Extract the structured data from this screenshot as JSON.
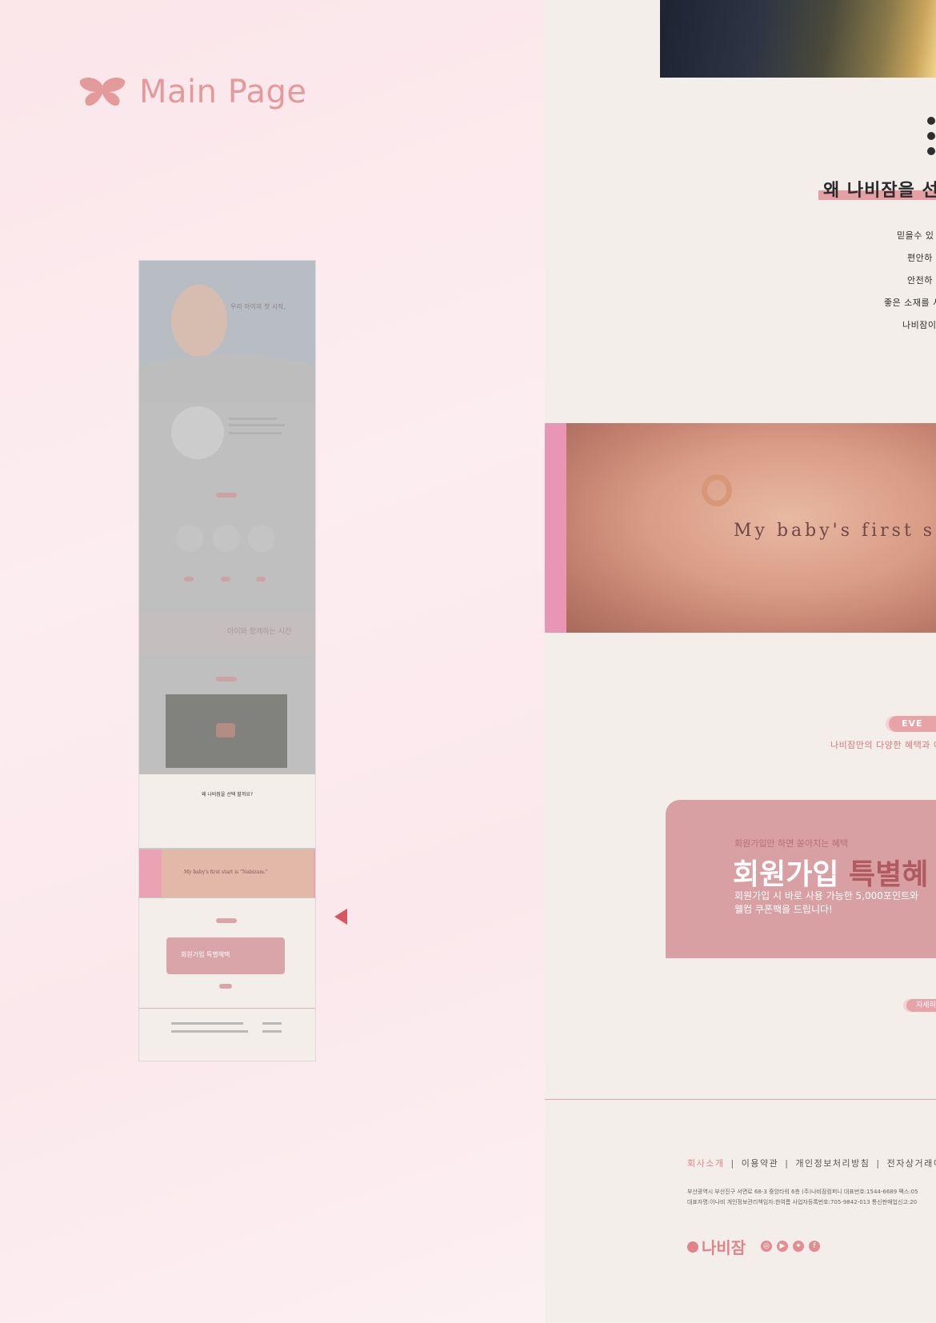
{
  "left": {
    "title": "Main Page",
    "thumbnail": {
      "hero_text": "우리 아이의 첫 시작,",
      "band_text": "아이와 함께하는 시간",
      "cream_title": "왜 나비잠을 선택 할까요?",
      "hand_text": "My baby's first start is \"Nabizam.\"",
      "card_text": "회원가입 특별혜택"
    }
  },
  "right": {
    "why_title": "왜 나비잠을 선",
    "reasons": [
      "믿을수 있",
      "편안하",
      "안전하",
      "좋은 소재를 사",
      "나비잠이"
    ],
    "hero_text": "My baby's first s",
    "event": {
      "pill": "EVE",
      "subtitle": "나비잠만의 다양한 혜택과 이"
    },
    "member": {
      "small": "회원가입만 하면 쏟아지는 혜택",
      "title_main": "회원가입 ",
      "title_accent": "특별혜",
      "desc_line1": "회원가입 시 바로 사용 가능한 5,000포인트와",
      "desc_line2": "웰컴 쿠폰팩을 드립니다!"
    },
    "detail_button": "자세히",
    "footer": {
      "links": [
        "회사소개",
        "이용약관",
        "개인정보처리방침",
        "전자상거래이"
      ],
      "info_line1": "부산광역시 부산진구 서면로 68-3 중앙타워 6층 (주)나비잠컴퍼니  대표번호:1544-6689  팩스:05",
      "info_line2": "대표자명:이나비  개인정보관리책임자:한여름  사업자등록번호:705-9842-013  통신판매업신고:20",
      "logo_text": "나비잠",
      "socials": [
        "instagram-icon",
        "youtube-icon",
        "twitter-icon",
        "facebook-icon"
      ]
    }
  },
  "colors": {
    "accent": "#e0848a",
    "card": "#d9a0a4",
    "cream": "#f4eeea",
    "bg": "#fbeff2"
  }
}
